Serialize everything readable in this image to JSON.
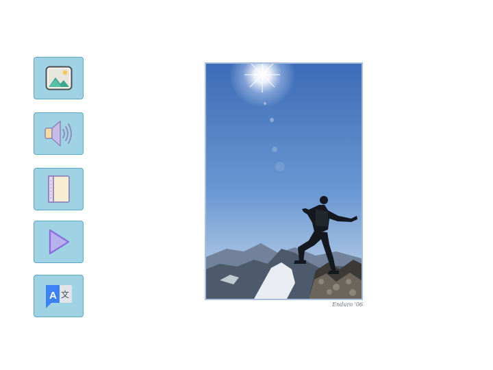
{
  "toolbar": {
    "buttons": [
      {
        "icon": "image-icon",
        "color": "#9fd3e4"
      },
      {
        "icon": "speaker-icon",
        "color": "#9fd3e4"
      },
      {
        "icon": "notebook-icon",
        "color": "#9fd3e4"
      },
      {
        "icon": "play-icon",
        "color": "#9fd3e4"
      },
      {
        "icon": "translate-icon",
        "color": "#9fd3e4",
        "glyph_a": "A",
        "glyph_b": "文"
      }
    ]
  },
  "photo": {
    "signature": "Enduro '06"
  },
  "colors": {
    "button_fill": "#9fd3e4",
    "button_border": "#5aa8c2",
    "photo_border": "#a7bfdc"
  }
}
